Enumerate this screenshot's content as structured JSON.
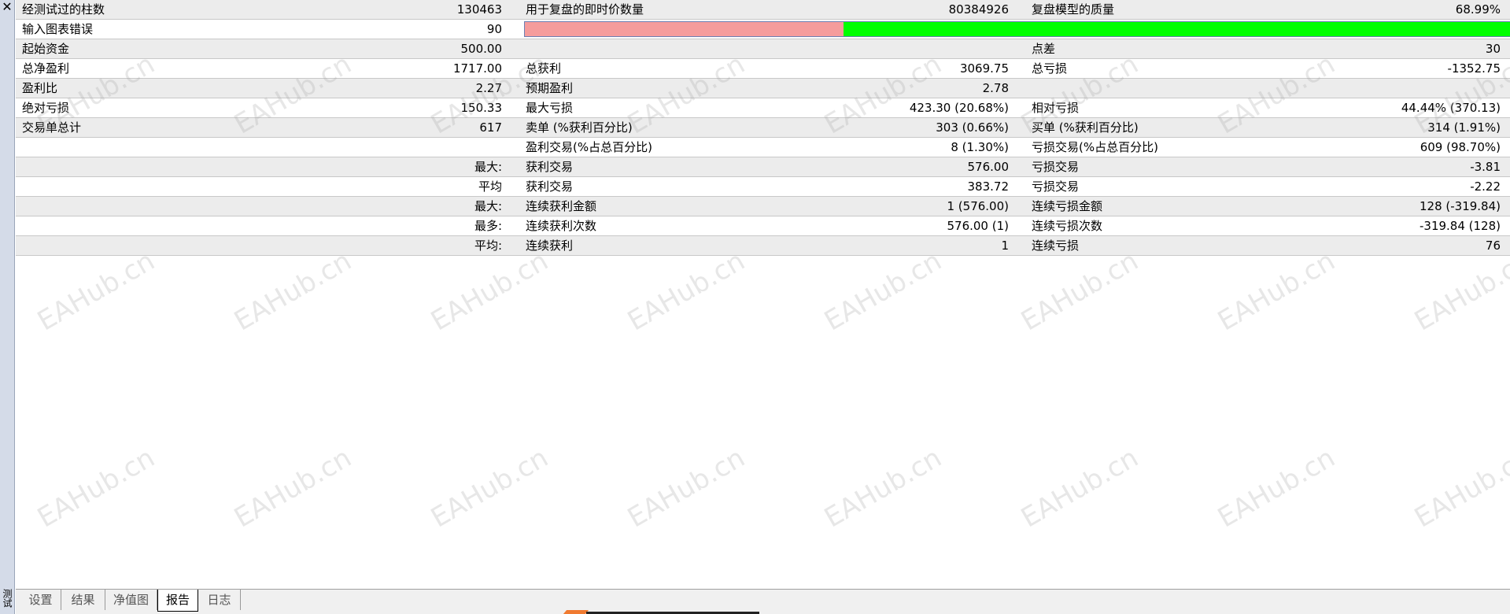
{
  "sidebar": {
    "close_glyph": "✕",
    "label": "测试"
  },
  "rows": [
    {
      "alt": true,
      "l1": "经测试过的柱数",
      "v1": "130463",
      "l2": "用于复盘的即时价数量",
      "v2": "80384926",
      "l3": "复盘模型的质量",
      "v3": "68.99%"
    },
    {
      "alt": false,
      "l1": "输入图表错误",
      "v1": "90",
      "bar": true
    },
    {
      "alt": true,
      "l1": "起始资金",
      "v1": "500.00",
      "l2": "",
      "v2": "",
      "l3": "点差",
      "v3": "30"
    },
    {
      "alt": false,
      "l1": "总净盈利",
      "v1": "1717.00",
      "l2": "总获利",
      "v2": "3069.75",
      "l3": "总亏损",
      "v3": "-1352.75"
    },
    {
      "alt": true,
      "l1": "盈利比",
      "v1": "2.27",
      "l2": "预期盈利",
      "v2": "2.78",
      "l3": "",
      "v3": ""
    },
    {
      "alt": false,
      "l1": "绝对亏损",
      "v1": "150.33",
      "l2": "最大亏损",
      "v2": "423.30 (20.68%)",
      "l3": "相对亏损",
      "v3": "44.44% (370.13)"
    },
    {
      "alt": true,
      "l1": "交易单总计",
      "v1": "617",
      "l2": "卖单 (%获利百分比)",
      "v2": "303 (0.66%)",
      "l3": "买单 (%获利百分比)",
      "v3": "314 (1.91%)"
    },
    {
      "alt": false,
      "l1": "",
      "v1": "",
      "l2": "盈利交易(%占总百分比)",
      "v2": "8 (1.30%)",
      "l3": "亏损交易(%占总百分比)",
      "v3": "609 (98.70%)"
    },
    {
      "alt": true,
      "l1": "",
      "v1": "最大:",
      "l2": "获利交易",
      "v2": "576.00",
      "l3": "亏损交易",
      "v3": "-3.81"
    },
    {
      "alt": false,
      "l1": "",
      "v1": "平均",
      "l2": "获利交易",
      "v2": "383.72",
      "l3": "亏损交易",
      "v3": "-2.22"
    },
    {
      "alt": true,
      "l1": "",
      "v1": "最大:",
      "l2": "连续获利金额",
      "v2": "1 (576.00)",
      "l3": "连续亏损金额",
      "v3": "128 (-319.84)"
    },
    {
      "alt": false,
      "l1": "",
      "v1": "最多:",
      "l2": "连续获利次数",
      "v2": "576.00 (1)",
      "l3": "连续亏损次数",
      "v3": "-319.84 (128)"
    },
    {
      "alt": true,
      "l1": "",
      "v1": "平均:",
      "l2": "连续获利",
      "v2": "1",
      "l3": "连续亏损",
      "v3": "76"
    }
  ],
  "quality_bar": {
    "bad_color": "#f59c9c",
    "good_color": "#00ff00"
  },
  "watermark_text": "EAHub.cn",
  "tabs": [
    {
      "label": "设置",
      "active": false
    },
    {
      "label": "结果",
      "active": false
    },
    {
      "label": "净值图",
      "active": false
    },
    {
      "label": "报告",
      "active": true
    },
    {
      "label": "日志",
      "active": false
    }
  ]
}
